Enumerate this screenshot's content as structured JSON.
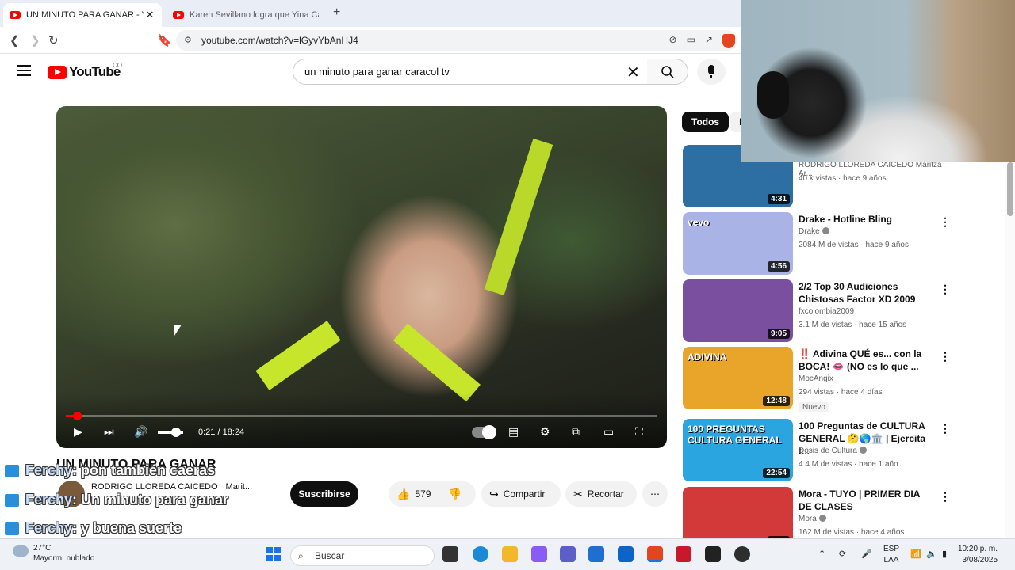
{
  "browser": {
    "tabs": [
      {
        "title": "UN MINUTO PARA GANAR - You",
        "active": true
      },
      {
        "title": "Karen Sevillano logra que Yina Calde",
        "active": false
      }
    ],
    "url": "youtube.com/watch?v=lGyvYbAnHJ4"
  },
  "youtube": {
    "logo_text": "YouTube",
    "country": "CO",
    "search_query": "un minuto para ganar caracol tv"
  },
  "player": {
    "time": "0:21 / 18:24",
    "progress_fraction": 0.019,
    "volume_fraction": 0.6
  },
  "video": {
    "title": "UN MINUTO PARA GANAR",
    "channel": "RODRIGO LLOREDA CAICEDO",
    "channel_extra": "Marit...",
    "subscribe_label": "Suscribirse",
    "likes": "579",
    "share_label": "Compartir",
    "clip_label": "Recortar"
  },
  "chat": [
    {
      "name": "Ferchy",
      "message": ": pon también caeras"
    },
    {
      "name": "Ferchy",
      "message": ": Un minuto para ganar"
    },
    {
      "name": "Ferchy",
      "message": ": y buena suerte"
    }
  ],
  "sidebar": {
    "chips": [
      "Todos",
      "D"
    ],
    "recommendations": [
      {
        "title": "",
        "channel": "RODRIGO LLOREDA CAICEDO Maritza Ar...",
        "meta": "40 k vistas · hace 9 años",
        "duration": "4:31",
        "verified": false,
        "badge": "",
        "thumb_color": "#2d6fa3"
      },
      {
        "title": "Drake - Hotline Bling",
        "channel": "Drake",
        "meta": "2084 M de vistas · hace 9 años",
        "duration": "4:56",
        "verified": true,
        "badge": "",
        "thumb_color": "#a9b3e6",
        "thumb_label": "vevo"
      },
      {
        "title": "2/2 Top 30 Audiciones Chistosas Factor XD  2009",
        "channel": "fxcolombia2009",
        "meta": "3.1 M de vistas · hace 15 años",
        "duration": "9:05",
        "verified": false,
        "badge": "",
        "thumb_color": "#7b4fa0"
      },
      {
        "title": "‼️ Adivina QUÉ es... con la BOCA! 👄 (NO es lo que ...",
        "channel": "MocAngix",
        "meta": "294 vistas · hace 4 días",
        "duration": "12:48",
        "verified": false,
        "badge": "Nuevo",
        "thumb_color": "#e9a52a",
        "thumb_label": "ADIVINA"
      },
      {
        "title": "100 Preguntas de CULTURA GENERAL 🤔🌎🏛️ | Ejercita t...",
        "channel": "Dosis de Cultura",
        "meta": "4.4 M de vistas · hace 1 año",
        "duration": "22:54",
        "verified": true,
        "badge": "",
        "thumb_color": "#2aa5e0",
        "thumb_label": "100 PREGUNTAS CULTURA GENERAL"
      },
      {
        "title": "Mora - TUYO | PRIMER DIA DE CLASES",
        "channel": "Mora",
        "meta": "162 M de vistas · hace 4 años",
        "duration": "4:20",
        "verified": true,
        "badge": "",
        "thumb_color": "#d23a3a"
      }
    ]
  },
  "taskbar": {
    "weather_temp": "27°C",
    "weather_desc": "Mayorm. nublado",
    "search_placeholder": "Buscar",
    "lang_1": "ESP",
    "lang_2": "LAA",
    "time": "10:20 p. m.",
    "date": "3/08/2025"
  }
}
